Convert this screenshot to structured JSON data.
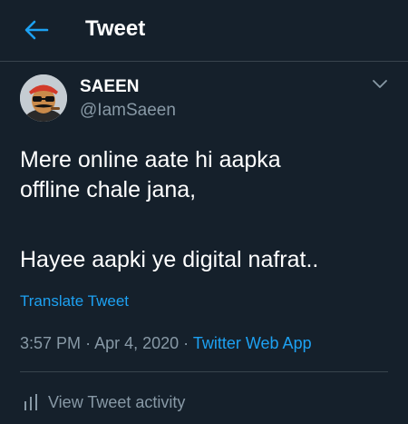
{
  "header": {
    "back_icon": "arrow-left-icon",
    "title": "Tweet"
  },
  "tweet": {
    "author": {
      "display_name": "SAEEN",
      "handle": "@IamSaeen",
      "avatar_icon": "avatar-cartoon"
    },
    "menu_icon": "chevron-down-icon",
    "text_lines": [
      "Mere online aate hi aapka",
      "offline chale jana,",
      "Hayee aapki ye digital nafrat.."
    ],
    "translate_label": "Translate Tweet",
    "time": "3:57 PM",
    "separator": "·",
    "date": "Apr 4, 2020",
    "source": "Twitter Web App",
    "activity_label": "View Tweet activity",
    "activity_icon": "bar-chart-icon"
  },
  "colors": {
    "background": "#15202b",
    "accent": "#1da1f2",
    "secondary_text": "#8899a6",
    "divider": "#38444d"
  }
}
